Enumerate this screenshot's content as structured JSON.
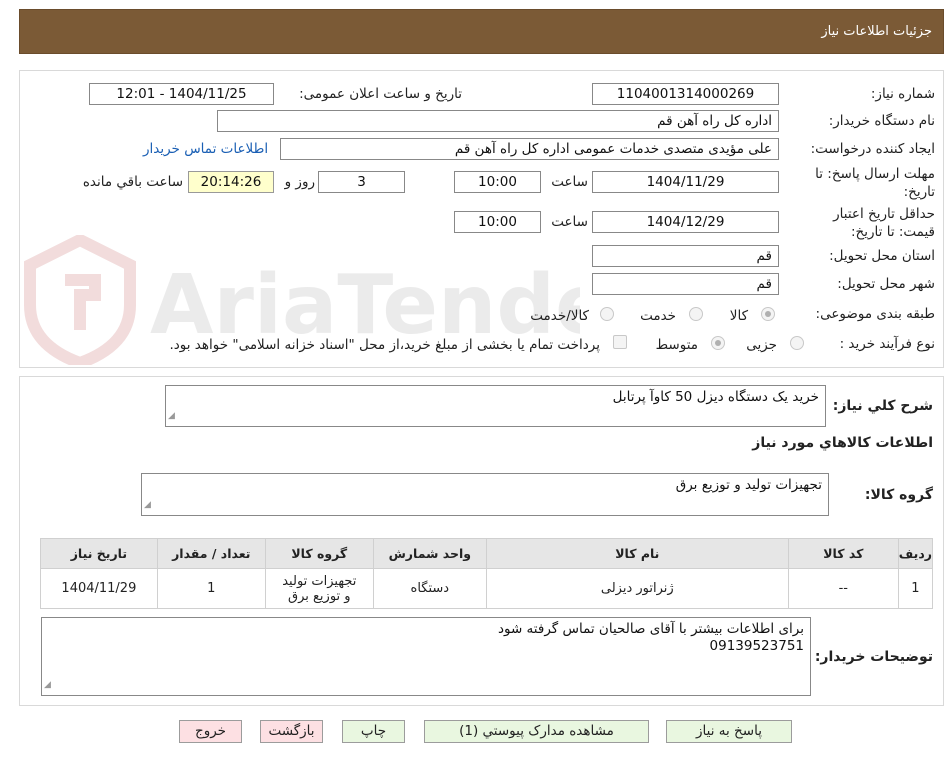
{
  "header": {
    "title": "جزئیات اطلاعات نیاز"
  },
  "info": {
    "need_number_label": "شماره نیاز:",
    "need_number": "1104001314000269",
    "announce_label": "تاریخ و ساعت اعلان عمومی:",
    "announce_value": "1404/11/25 - 12:01",
    "buyer_org_label": "نام دستگاه خریدار:",
    "buyer_org": "اداره کل  راه آهن قم",
    "creator_label": "ایجاد کننده درخواست:",
    "creator": "علی مؤیدی متصدی خدمات عمومی اداره کل  راه آهن قم",
    "contact_link": "اطلاعات تماس خریدار",
    "deadline_label_1": "مهلت ارسال پاسخ: تا",
    "deadline_label_2": "تاریخ:",
    "deadline_date": "1404/11/29",
    "time_word": "ساعت",
    "deadline_time": "10:00",
    "days_value": "3",
    "days_word": "روز و",
    "remaining_time": "20:14:26",
    "remaining_word": "ساعت باقي مانده",
    "validity_label_1": "حداقل تاریخ اعتبار",
    "validity_label_2": "قیمت: تا تاریخ:",
    "validity_date": "1404/12/29",
    "validity_time": "10:00",
    "province_label": "استان محل تحویل:",
    "province": "قم",
    "city_label": "شهر محل تحویل:",
    "city": "قم",
    "category_label": "طبقه بندی موضوعی:",
    "category_options": [
      "کالا",
      "خدمت",
      "کالا/خدمت"
    ],
    "process_label": "نوع فرآیند خرید :",
    "process_options": [
      "جزیی",
      "متوسط"
    ],
    "payment_note": "پرداخت تمام یا بخشی از مبلغ خرید،از محل \"اسناد خزانه اسلامی\" خواهد بود."
  },
  "watermark": {
    "text": "AriaTender.neT"
  },
  "details": {
    "summary_label": "شرح کلي نياز:",
    "summary": "خرید یک دستگاه دیزل 50 کاوآ پرتابل",
    "goods_section": "اطلاعات کالاهاي مورد نياز",
    "goods_group_label": "گروه کالا:",
    "goods_group": "تجهیزات تولید و توزیع برق",
    "buyer_notes_label": "توضیحات خریدار:",
    "buyer_notes_line1": "برای اطلاعات بیشتر با آقای صالحیان تماس گرفته شود",
    "buyer_notes_line2": "09139523751"
  },
  "table": {
    "headers": [
      "رديف",
      "کد کالا",
      "نام کالا",
      "واحد شمارش",
      "گروه کالا",
      "تعداد / مقدار",
      "تاریخ نیاز"
    ],
    "rows": [
      [
        "1",
        "--",
        "ژنراتور دیزلی",
        "دستگاه",
        "تجهیزات تولید و توزیع برق",
        "1",
        "1404/11/29"
      ]
    ]
  },
  "buttons": {
    "reply": "پاسخ به نياز",
    "attachments": "مشاهده مدارک پيوستي (1)",
    "print": "چاپ",
    "back": "بازگشت",
    "exit": "خروج"
  },
  "colors": {
    "header_bg": "#7b5a36",
    "button_green": "#e9f7e0",
    "button_red": "#fde0e3",
    "link": "#1a5fb4"
  }
}
